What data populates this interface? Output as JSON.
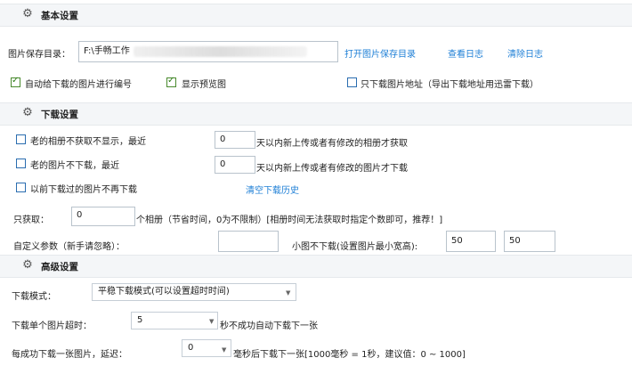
{
  "sections": {
    "basic": {
      "title": "基本设置"
    },
    "download": {
      "title": "下载设置"
    },
    "advanced": {
      "title": "高级设置"
    }
  },
  "basic": {
    "save_dir_label": "图片保存目录：",
    "save_dir_value": "F:\\手畅工作",
    "open_dir_link": "打开图片保存目录",
    "view_log_link": "查看日志",
    "clear_log_link": "清除日志",
    "auto_number_label": "自动给下载的图片进行编号",
    "auto_number_checked": true,
    "show_preview_label": "显示预览图",
    "show_preview_checked": true,
    "only_address_label": "只下载图片地址（导出下载地址用迅雷下载）",
    "only_address_checked": false
  },
  "download": {
    "old_album_label": "老的相册不获取不显示，最近",
    "old_album_value": "0",
    "old_album_suffix": "天以内新上传或者有修改的相册才获取",
    "old_image_label": "老的图片不下载，最近",
    "old_image_value": "0",
    "old_image_suffix": "天以内新上传或者有修改的图片才下载",
    "no_redownload_label": "以前下载过的图片不再下载",
    "clear_history_link": "清空下载历史",
    "only_fetch_label": "只获取：",
    "only_fetch_value": "0",
    "only_fetch_suffix": "个相册（节省时间，0为不限制）[相册时间无法获取时指定个数即可，推荐！]",
    "custom_param_label": "自定义参数（新手请忽略）：",
    "custom_param_value": "",
    "min_size_label": "小图不下载(设置图片最小宽高):",
    "min_width_value": "50",
    "min_height_value": "50"
  },
  "advanced": {
    "mode_label": "下载模式：",
    "mode_value": "平稳下载模式(可以设置超时时间)",
    "timeout_label": "下载单个图片超时：",
    "timeout_value": "5",
    "timeout_suffix": "秒不成功自动下载下一张",
    "delay_label": "每成功下载一张图片，延迟：",
    "delay_value": "0",
    "delay_suffix": "毫秒后下载下一张[1000毫秒 = 1秒，建议值：0 ~ 1000]"
  }
}
